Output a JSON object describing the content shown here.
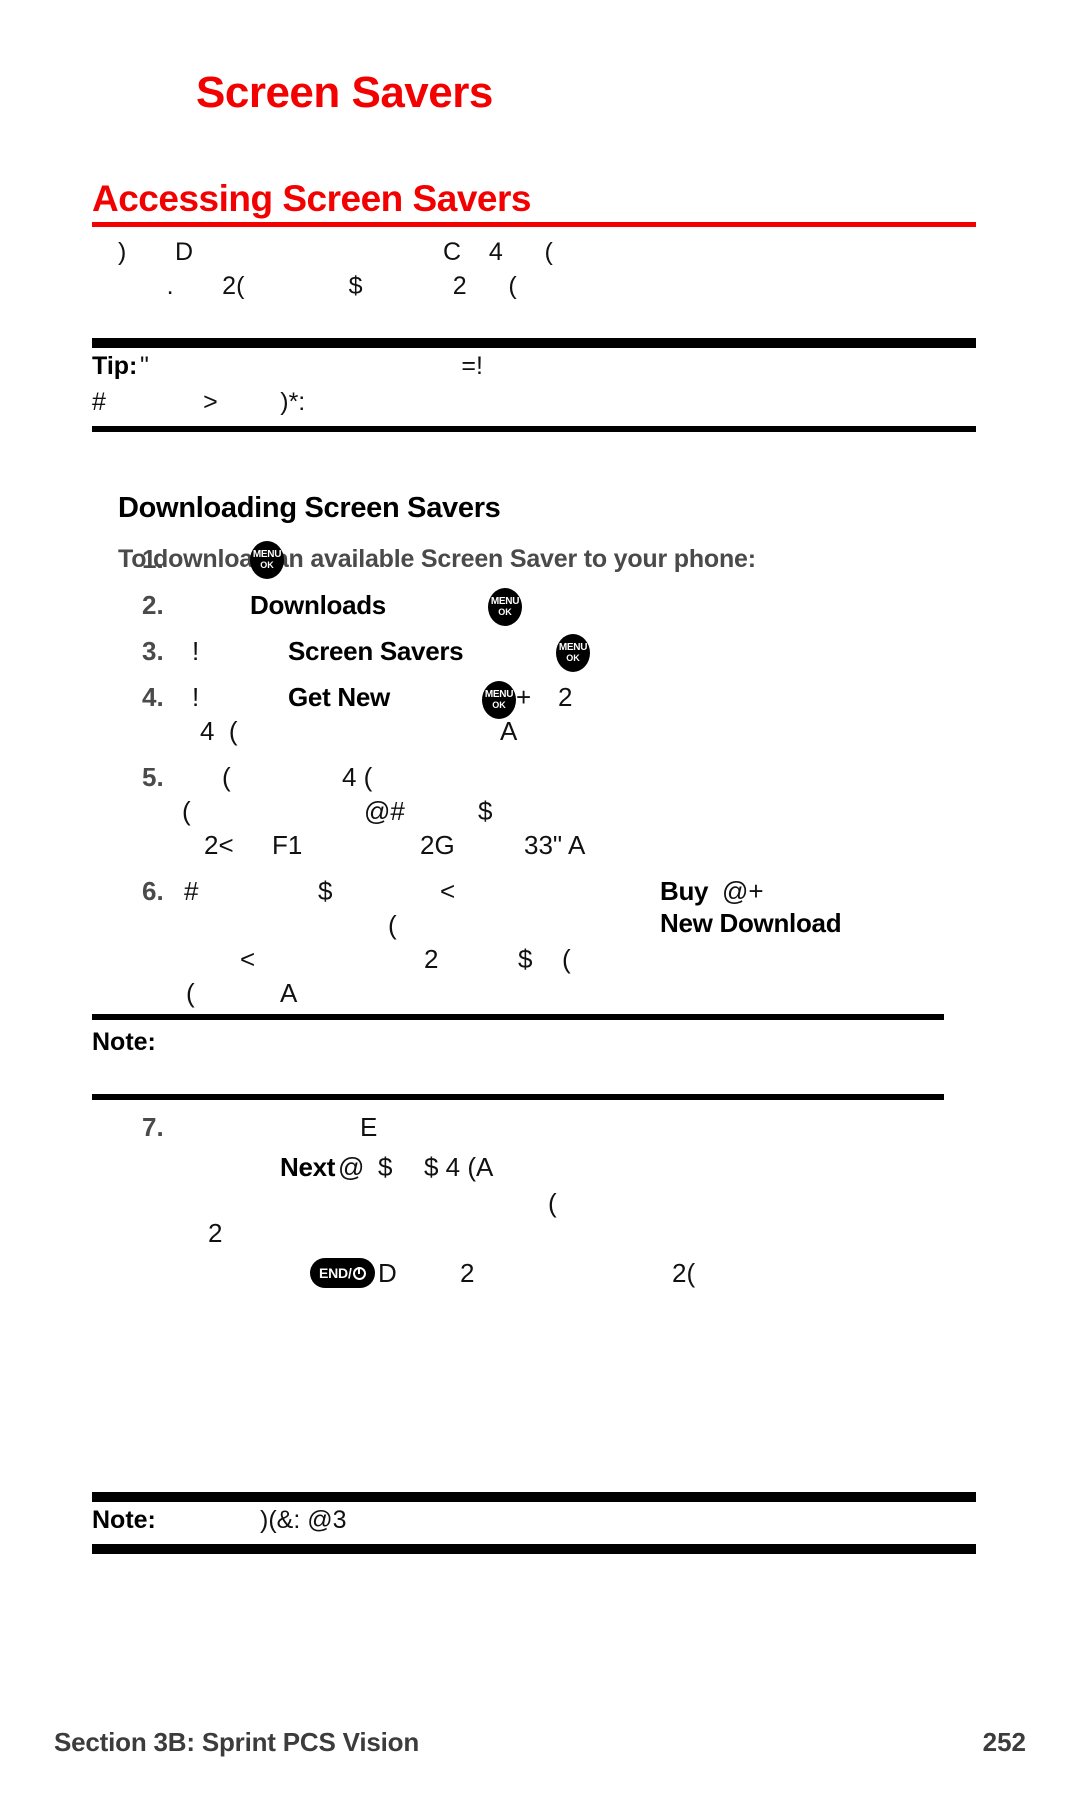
{
  "colors": {
    "heading_red": "#f30000",
    "body_black": "#111111",
    "muted_gray": "#4a4a4a",
    "footer_gray": "#3c3c3c"
  },
  "header": {
    "chapter_title": "Screen Savers",
    "section_title": "Accessing Screen Savers"
  },
  "intro": {
    "line1": ")       D                                    C    4      (",
    "line2": "       .       2(               $             2      ("
  },
  "tip_box": {
    "label": "Tip:",
    "line1_glyphs": "\"                                             =!",
    "line2_glyphs": "#              >         )*:"
  },
  "downloading": {
    "subheading": "Downloading Screen Savers",
    "intro": "To download an available Screen Saver to your phone:"
  },
  "steps": [
    {
      "number": "1.",
      "lines": [
        {
          "segments": [
            {
              "type": "key",
              "icon": "menu-ok-key"
            }
          ]
        }
      ]
    },
    {
      "number": "2.",
      "lines": [
        {
          "segments": [
            {
              "type": "bold",
              "text": "Downloads"
            },
            {
              "type": "key",
              "icon": "menu-ok-key"
            }
          ]
        }
      ]
    },
    {
      "number": "3.",
      "lines": [
        {
          "segments": [
            {
              "type": "glyph",
              "text": "!"
            },
            {
              "type": "bold",
              "text": "Screen Savers"
            },
            {
              "type": "key",
              "icon": "menu-ok-key"
            }
          ]
        }
      ]
    },
    {
      "number": "4.",
      "lines": [
        {
          "segments": [
            {
              "type": "glyph",
              "text": "!"
            },
            {
              "type": "bold",
              "text": "Get New"
            },
            {
              "type": "key",
              "icon": "menu-ok-key"
            },
            {
              "type": "glyph",
              "text": "+"
            },
            {
              "type": "glyph",
              "text": "2"
            }
          ]
        },
        {
          "segments": [
            {
              "type": "glyph",
              "text": "4  ("
            },
            {
              "type": "glyph",
              "text": "A"
            }
          ]
        }
      ]
    },
    {
      "number": "5.",
      "lines": [
        {
          "segments": [
            {
              "type": "glyph",
              "text": "("
            },
            {
              "type": "glyph",
              "text": "4 ("
            }
          ]
        },
        {
          "segments": [
            {
              "type": "glyph",
              "text": "("
            },
            {
              "type": "glyph",
              "text": "@#"
            },
            {
              "type": "glyph",
              "text": "$"
            }
          ]
        },
        {
          "segments": [
            {
              "type": "glyph",
              "text": "2<"
            },
            {
              "type": "glyph",
              "text": "F1"
            },
            {
              "type": "glyph",
              "text": "2G"
            },
            {
              "type": "glyph",
              "text": "33\" A"
            }
          ]
        }
      ]
    },
    {
      "number": "6.",
      "lines": [
        {
          "segments": [
            {
              "type": "glyph",
              "text": "#"
            },
            {
              "type": "glyph",
              "text": "$"
            },
            {
              "type": "glyph",
              "text": "<"
            },
            {
              "type": "bold",
              "text": "Buy"
            },
            {
              "type": "glyph",
              "text": "@+"
            }
          ]
        },
        {
          "segments": [
            {
              "type": "glyph",
              "text": "("
            },
            {
              "type": "bold",
              "text": "New Download"
            }
          ]
        },
        {
          "segments": [
            {
              "type": "glyph",
              "text": "<"
            },
            {
              "type": "glyph",
              "text": "2"
            },
            {
              "type": "glyph",
              "text": "$"
            },
            {
              "type": "glyph",
              "text": "("
            }
          ]
        },
        {
          "segments": [
            {
              "type": "glyph",
              "text": "("
            },
            {
              "type": "glyph",
              "text": "A"
            }
          ]
        }
      ]
    },
    {
      "number": "7.",
      "lines": [
        {
          "segments": [
            {
              "type": "glyph",
              "text": "E"
            }
          ]
        },
        {
          "segments": [
            {
              "type": "bold",
              "text": "Next"
            },
            {
              "type": "glyph",
              "text": "@"
            },
            {
              "type": "glyph",
              "text": "$"
            },
            {
              "type": "glyph",
              "text": "$ 4 (A"
            }
          ]
        },
        {
          "segments": [
            {
              "type": "glyph",
              "text": "("
            }
          ]
        },
        {
          "segments": [
            {
              "type": "glyph",
              "text": "2"
            }
          ]
        },
        {
          "segments": [
            {
              "type": "key",
              "icon": "end-power-key"
            },
            {
              "type": "glyph",
              "text": "D"
            },
            {
              "type": "glyph",
              "text": "2"
            },
            {
              "type": "glyph",
              "text": "2("
            }
          ]
        }
      ]
    }
  ],
  "note_box_1": {
    "label": "Note:",
    "text": ""
  },
  "note_box_2": {
    "label": "Note:",
    "text": ")(&: @3"
  },
  "keys": {
    "menu_ok": {
      "line1": "MENU",
      "line2": "OK"
    },
    "end_power": {
      "label": "END/"
    }
  },
  "footer": {
    "left": "Section 3B: Sprint PCS Vision",
    "page_number": "252"
  }
}
